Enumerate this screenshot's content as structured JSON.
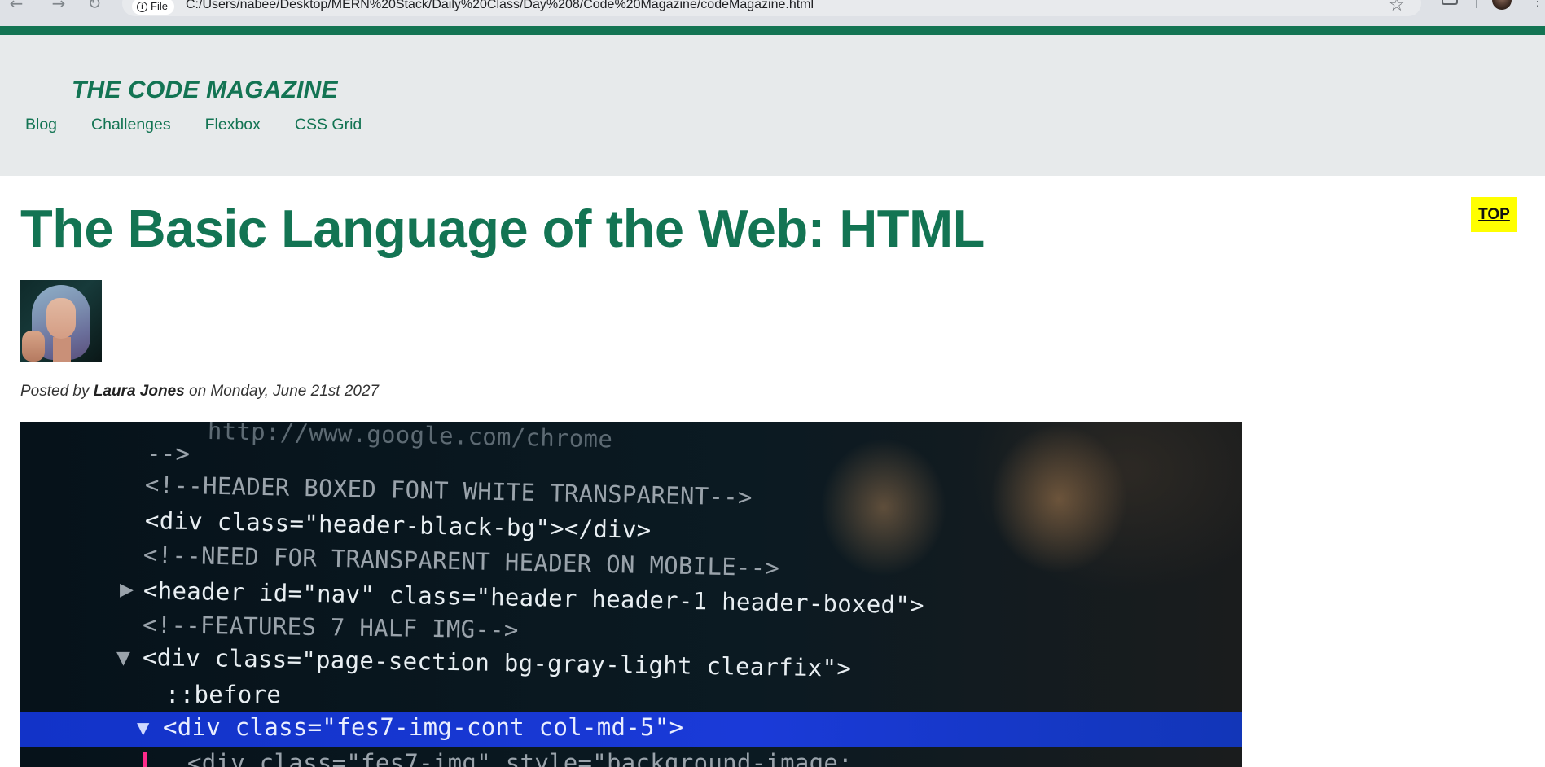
{
  "browser": {
    "site_info_label": "File",
    "url": "C:/Users/nabee/Desktop/MERN%20Stack/Daily%20Class/Day%208/Code%20Magazine/codeMagazine.html",
    "icons": [
      "back-arrow-icon",
      "forward-arrow-icon",
      "reload-icon",
      "info-icon",
      "star-icon",
      "extensions-icon",
      "profile-avatar",
      "menu-dots-icon"
    ]
  },
  "header": {
    "site_title": "THE CODE MAGAZINE",
    "nav": [
      {
        "label": "Blog"
      },
      {
        "label": "Challenges"
      },
      {
        "label": "Flexbox"
      },
      {
        "label": "CSS Grid"
      }
    ]
  },
  "article": {
    "title": "The Basic Language of the Web: HTML",
    "byline": {
      "prefix": "Posted by",
      "author": "Laura Jones",
      "connector": "on",
      "date": "Monday, June 21st 2027"
    },
    "code_image_lines": [
      "http://www.google.com/chrome",
      "-->",
      "<!--HEADER BOXED FONT WHITE TRANSPARENT-->",
      "<div class=\"header-black-bg\"></div>",
      "<!--NEED FOR TRANSPARENT HEADER ON MOBILE-->",
      "<header id=\"nav\" class=\"header header-1 header-boxed\">",
      "<!--FEATURES 7 HALF IMG-->",
      "<div class=\"page-section bg-gray-light clearfix\">",
      "::before",
      "<div class=\"fes7-img-cont col-md-5\">",
      "<div class=\"fes7-img\" style=\"background-image:"
    ]
  },
  "top_button": {
    "label": "TOP"
  },
  "colors": {
    "brand_green": "#137453",
    "header_bg": "#e7eaeb",
    "top_button_bg": "#ffff00"
  }
}
